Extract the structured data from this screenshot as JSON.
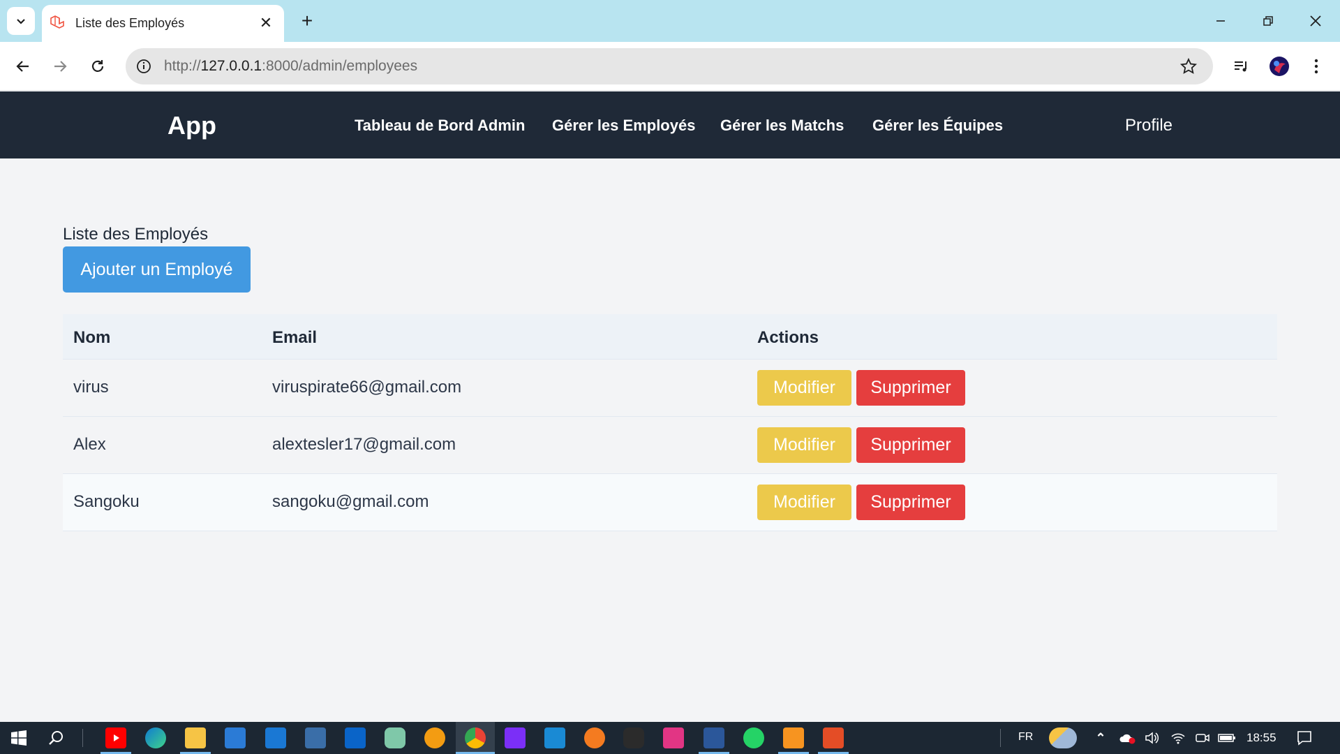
{
  "browser": {
    "tab_title": "Liste des Employés",
    "url_prefix": "http://",
    "url_host": "127.0.0.1",
    "url_rest": ":8000/admin/employees"
  },
  "navbar": {
    "brand": "App",
    "links": [
      "Tableau de Bord Admin",
      "Gérer les Employés",
      "Gérer les Matchs",
      "Gérer les Équipes"
    ],
    "profile": "Profile"
  },
  "content": {
    "title": "Liste des Employés",
    "add_button": "Ajouter un Employé",
    "columns": [
      "Nom",
      "Email",
      "Actions"
    ],
    "rows": [
      {
        "name": "virus",
        "email": "viruspirate66@gmail.com"
      },
      {
        "name": "Alex",
        "email": "alextesler17@gmail.com"
      },
      {
        "name": "Sangoku",
        "email": "sangoku@gmail.com"
      }
    ],
    "edit_label": "Modifier",
    "delete_label": "Supprimer"
  },
  "taskbar": {
    "language": "FR",
    "time": "18:55"
  },
  "colors": {
    "navbar": "#1f2937",
    "primary": "#4299e1",
    "edit": "#ecc94b",
    "delete": "#e53e3e"
  }
}
